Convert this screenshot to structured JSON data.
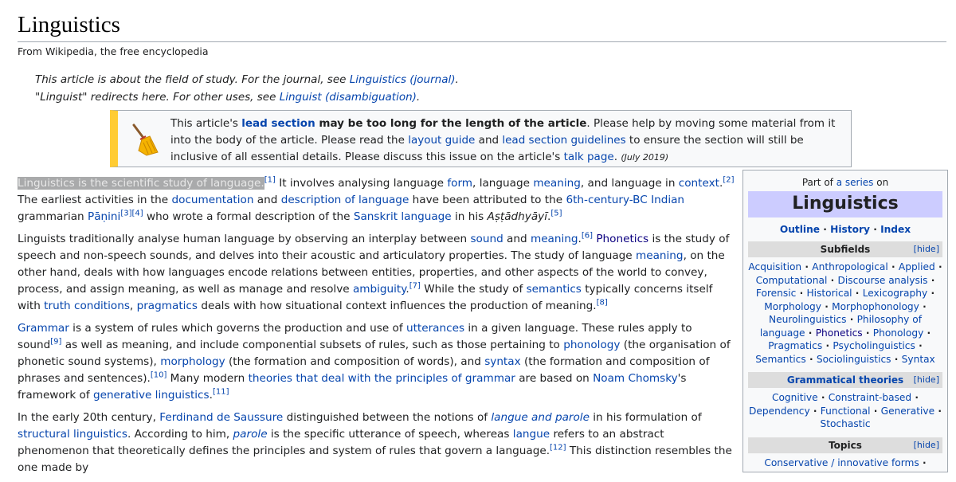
{
  "title": "Linguistics",
  "tagline": "From Wikipedia, the free encyclopedia",
  "hatnotes": {
    "h1_pre": "This article is about the field of study. For the journal, see ",
    "h1_link": "Linguistics (journal)",
    "h1_post": ".",
    "h2_pre": "\"Linguist\" redirects here. For other uses, see ",
    "h2_link": "Linguist (disambiguation)",
    "h2_post": "."
  },
  "ambox": {
    "t1": "This article's ",
    "l1": "lead section",
    "t2": " may be too long for the length of the article",
    "t3": ". Please help by moving some material from it into the body of the article. Please read the ",
    "l2": "layout guide",
    "t4": " and ",
    "l3": "lead section guidelines",
    "t5": " to ensure the section will still be inclusive of all essential details. Please discuss this issue on the article's ",
    "l4": "talk page",
    "t6": ". ",
    "date": "(July 2019)"
  },
  "p1": {
    "hl": "Linguistics is the scientific study of language.",
    "r1": "[1]",
    "a": " It involves analysing language ",
    "form": "form",
    "b": ", language ",
    "meaning": "meaning",
    "c": ", and language in ",
    "context": "context",
    "d": ".",
    "r2": "[2]",
    "e": " The earliest activities in the ",
    "documentation": "documentation",
    "f": " and ",
    "description": "description of language",
    "g": " have been attributed to the ",
    "indian": "6th-century-BC Indian",
    "h": " grammarian ",
    "panini": "Pāṇini",
    "r3": "[3]",
    "r4": "[4]",
    "i": " who wrote a formal description of the ",
    "sanskrit": "Sanskrit language",
    "j": " in his ",
    "ast": "Aṣṭādhyāyī",
    "k": ".",
    "r5": "[5]"
  },
  "p2": {
    "a": "Linguists traditionally analyse human language by observing an interplay between ",
    "sound": "sound",
    "b": " and ",
    "meaning": "meaning",
    "c": ".",
    "r6": "[6]",
    "d": " ",
    "phonetics": "Phonetics",
    "e": " is the study of speech and non-speech sounds, and delves into their acoustic and articulatory properties. The study of language ",
    "meaning2": "meaning",
    "f": ", on the other hand, deals with how languages encode relations between entities, properties, and other aspects of the world to convey, process, and assign meaning, as well as manage and resolve ",
    "ambiguity": "ambiguity",
    "g": ".",
    "r7": "[7]",
    "h": " While the study of ",
    "semantics": "semantics",
    "i": " typically concerns itself with ",
    "truth": "truth conditions",
    "j": ", ",
    "pragmatics": "pragmatics",
    "k": " deals with how situational context influences the production of meaning.",
    "r8": "[8]"
  },
  "p3": {
    "grammar": "Grammar",
    "a": " is a system of rules which governs the production and use of ",
    "utterances": "utterances",
    "b": " in a given language. These rules apply to sound",
    "r9": "[9]",
    "c": " as well as meaning, and include componential subsets of rules, such as those pertaining to ",
    "phonology": "phonology",
    "d": " (the organisation of phonetic sound systems), ",
    "morphology": "morphology",
    "e": " (the formation and composition of words), and ",
    "syntax": "syntax",
    "f": " (the formation and composition of phrases and sentences).",
    "r10": "[10]",
    "g": " Many modern ",
    "theories": "theories that deal with the principles of grammar",
    "h": " are based on ",
    "chomsky": "Noam Chomsky",
    "i": "'s framework of ",
    "generative": "generative linguistics",
    "j": ".",
    "r11": "[11]"
  },
  "p4": {
    "a": "In the early 20th century, ",
    "saussure": "Ferdinand de Saussure",
    "b": " distinguished between the notions of ",
    "langue_parole": "langue and parole",
    "c": " in his formulation of ",
    "structural": "structural linguistics",
    "d": ". According to him, ",
    "parole": "parole",
    "e": " is the specific utterance of speech, whereas ",
    "langue": "langue",
    "f": " refers to an abstract phenomenon that theoretically defines the principles and system of rules that govern a language.",
    "r12": "[12]",
    "g": " This distinction resembles the one made by"
  },
  "infobox": {
    "part_pre": "Part of ",
    "part_link": "a series",
    "part_post": " on",
    "title": "Linguistics",
    "nav": [
      "Outline",
      "History",
      "Index"
    ],
    "hide": "[hide]",
    "subfields_head": "Subfields",
    "subfields": [
      "Acquisition",
      "Anthropological",
      "Applied",
      "Computational",
      "Discourse analysis",
      "Forensic",
      "Historical",
      "Lexicography",
      "Morphology",
      "Morphophonology",
      "Neurolinguistics",
      "Philosophy of language",
      "Phonetics",
      "Phonology",
      "Pragmatics",
      "Psycholinguistics",
      "Semantics",
      "Sociolinguistics",
      "Syntax"
    ],
    "grammatical_head": "Grammatical theories",
    "grammatical": [
      "Cognitive",
      "Constraint-based",
      "Dependency",
      "Functional",
      "Generative",
      "Stochastic"
    ],
    "topics_head": "Topics",
    "topics": [
      "Conservative / innovative forms"
    ]
  }
}
